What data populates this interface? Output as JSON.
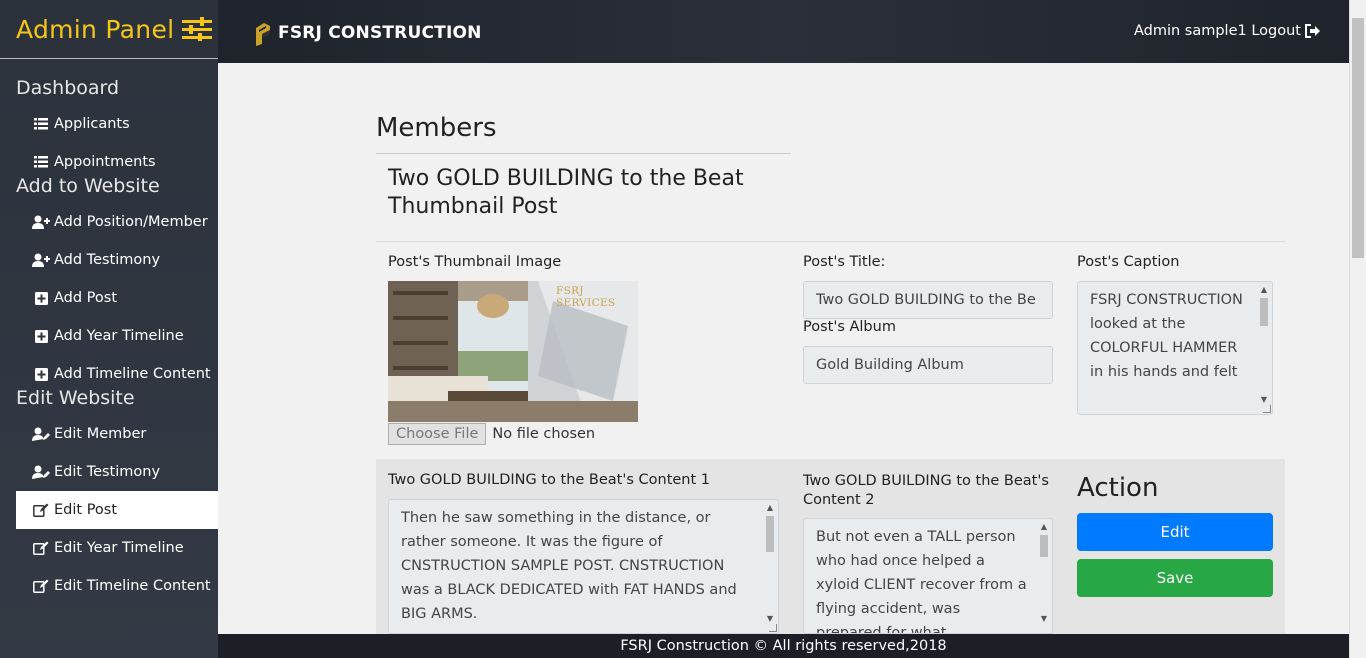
{
  "sidebar": {
    "brand": "Admin Panel",
    "brand_icon": "sliders-icon",
    "sections": {
      "dashboard": "Dashboard",
      "add": "Add to Website",
      "edit": "Edit Website"
    },
    "items": [
      {
        "label": "Applicants",
        "icon": "list-icon"
      },
      {
        "label": "Appointments",
        "icon": "list-icon"
      },
      {
        "label": "Add Position/Member",
        "icon": "user-plus-icon"
      },
      {
        "label": "Add Testimony",
        "icon": "user-plus-icon"
      },
      {
        "label": "Add Post",
        "icon": "plus-square-icon"
      },
      {
        "label": "Add Year Timeline",
        "icon": "plus-square-icon"
      },
      {
        "label": "Add Timeline Content",
        "icon": "plus-square-icon"
      },
      {
        "label": "Edit Member",
        "icon": "user-edit-icon"
      },
      {
        "label": "Edit Testimony",
        "icon": "user-edit-icon"
      },
      {
        "label": "Edit Post",
        "icon": "edit-icon",
        "active": true
      },
      {
        "label": "Edit Year Timeline",
        "icon": "edit-icon"
      },
      {
        "label": "Edit Timeline Content",
        "icon": "edit-icon"
      }
    ]
  },
  "header": {
    "logo_text": "FSRJ CONSTRUCTION",
    "user_text": "Admin sample1 Logout"
  },
  "main": {
    "page_title": "Members",
    "post_heading": "Two GOLD BUILDING to the Beat Thumbnail Post",
    "thumbnail_label": "Post's Thumbnail Image",
    "thumbnail_watermark": "FSRJ SERVICES",
    "file_button": "Choose File",
    "file_status": "No file chosen",
    "title_label": "Post's Title:",
    "title_value": "Two GOLD  BUILDING to the Be",
    "album_label": "Post's Album",
    "album_value": "Gold Building Album",
    "caption_label": "Post's Caption",
    "caption_value": "FSRJ CONSTRUCTION looked at the COLORFUL HAMMER in his hands and felt",
    "content1_label": "Two GOLD BUILDING to the Beat's Content 1",
    "content1_value": "Then he saw something in the distance, or rather someone. It was the figure of CNSTRUCTION SAMPLE POST. CNSTRUCTION was a BLACK DEDICATED with FAT HANDS and BIG ARMS.",
    "content2_label": "Two GOLD BUILDING to the Beat's Content 2",
    "content2_value": "But not even a TALL person who had once helped a xyloid CLIENT recover from a flying accident, was prepared for what",
    "action_title": "Action",
    "edit_button": "Edit",
    "save_button": "Save"
  },
  "footer": {
    "text": "FSRJ Construction © All rights reserved,2018"
  },
  "colors": {
    "brand_yellow": "#f5c518",
    "sidebar_bg": "#2f3540",
    "edit_blue": "#007bff",
    "save_green": "#28a745"
  }
}
